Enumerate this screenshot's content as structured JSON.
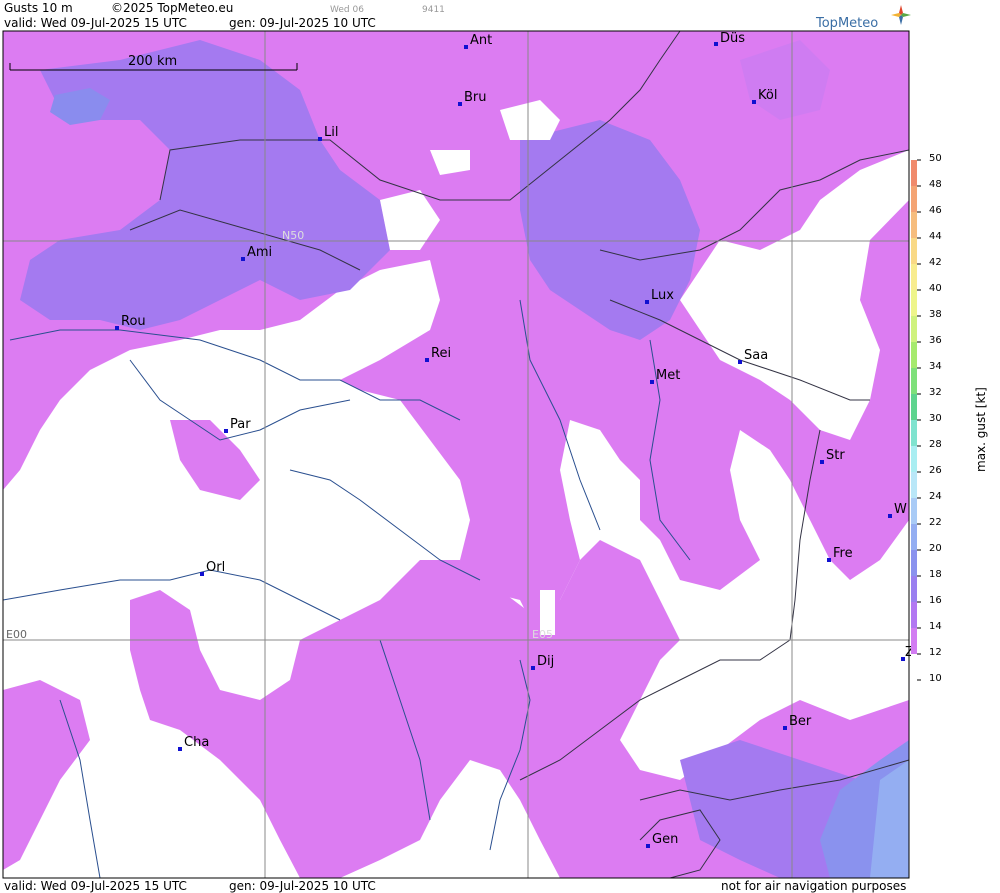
{
  "header": {
    "product": "Gusts 10 m",
    "copyright": "©2025 TopMeteo.eu",
    "faint_date": "Wed 06",
    "faint_code": "9411",
    "valid": "valid:  Wed  09-Jul-2025  15 UTC",
    "gen": "gen: 09-Jul-2025 10 UTC",
    "brand": "TopMeteo"
  },
  "footer": {
    "valid": "valid:  Wed  09-Jul-2025  15 UTC",
    "gen": "gen: 09-Jul-2025 10 UTC",
    "disclaimer": "not for air navigation purposes"
  },
  "map": {
    "scale_label": "200 km",
    "grid_labels": {
      "lat": "N50",
      "lon_west": "E00",
      "lon_east": "E05"
    },
    "cities": [
      {
        "label": "Ant"
      },
      {
        "label": "Düs"
      },
      {
        "label": "Köl"
      },
      {
        "label": "Bru"
      },
      {
        "label": "Lil"
      },
      {
        "label": "Ami"
      },
      {
        "label": "Rou"
      },
      {
        "label": "Lux"
      },
      {
        "label": "Rei"
      },
      {
        "label": "Saa"
      },
      {
        "label": "Met"
      },
      {
        "label": "Par"
      },
      {
        "label": "Str"
      },
      {
        "label": "W"
      },
      {
        "label": "Fre"
      },
      {
        "label": "Orl"
      },
      {
        "label": "Dij"
      },
      {
        "label": "Z"
      },
      {
        "label": "Ber"
      },
      {
        "label": "Cha"
      },
      {
        "label": "Gen"
      }
    ]
  },
  "legend": {
    "title": "max. gust [kt]",
    "ticks": [
      "50",
      "48",
      "46",
      "44",
      "42",
      "40",
      "38",
      "36",
      "34",
      "32",
      "30",
      "28",
      "26",
      "24",
      "22",
      "20",
      "18",
      "16",
      "14",
      "12",
      "10"
    ],
    "colors": [
      "#f08a6c",
      "#f4a474",
      "#f6bd7e",
      "#f9d986",
      "#f8ec8e",
      "#eef58a",
      "#cff27e",
      "#a6ea6e",
      "#7ee07a",
      "#5ed48e",
      "#7fe3cf",
      "#a9eef2",
      "#b9e7f8",
      "#a9cbf6",
      "#94aef2",
      "#8a92ee",
      "#9a7ff0",
      "#b277f2",
      "#d27cf2",
      "#ffffff"
    ],
    "accent": "#dc7cf2"
  }
}
